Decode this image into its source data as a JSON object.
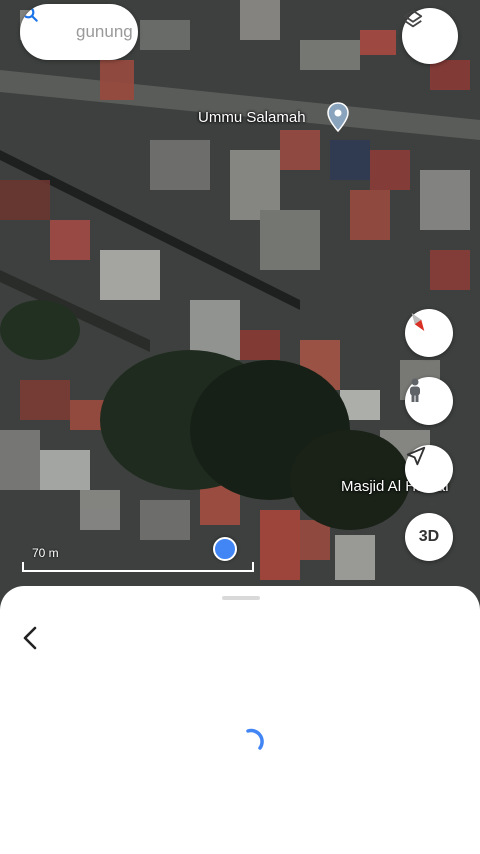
{
  "search": {
    "query": "gunung"
  },
  "map": {
    "places": [
      {
        "name": "Ummu Salamah"
      },
      {
        "name": "Masjid Al Humai"
      }
    ],
    "scale_label": "70 m",
    "mode_button_label": "3D"
  },
  "icons": {
    "search": "search-icon",
    "layers": "layers-icon",
    "place_pin": "place-pin-icon",
    "compass": "compass-icon",
    "pegman": "street-view-icon",
    "navigate": "navigation-arrow-icon",
    "back": "back-arrow-icon",
    "loading": "loading-spinner"
  },
  "colors": {
    "accent_blue": "#4285f4",
    "compass_red": "#d93025"
  }
}
